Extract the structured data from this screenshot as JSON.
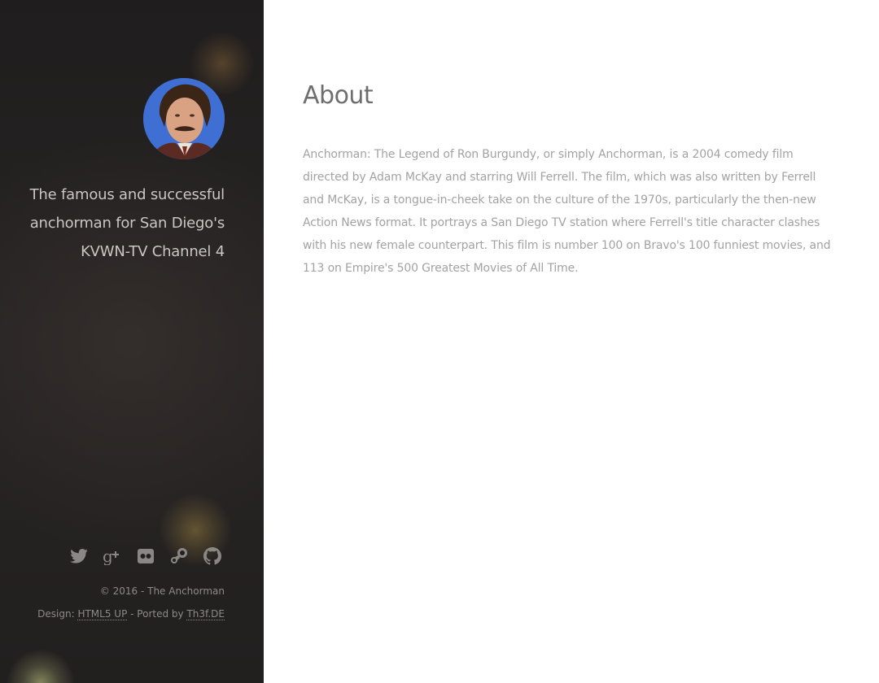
{
  "sidebar": {
    "avatar_alt": "Ron Burgundy",
    "tagline": "The famous and successful anchorman for San Diego's KVWN-TV Channel 4",
    "socials": [
      {
        "name": "twitter-icon"
      },
      {
        "name": "google-plus-icon"
      },
      {
        "name": "flickr-icon"
      },
      {
        "name": "steam-icon"
      },
      {
        "name": "github-icon"
      }
    ],
    "copyright": "© 2016 - The Anchorman",
    "credits_prefix": "Design: ",
    "credits_design_link": "HTML5 UP",
    "credits_middle": " - Ported by ",
    "credits_port_link": "Th3f.DE"
  },
  "main": {
    "title": "About",
    "text": "Anchorman: The Legend of Ron Burgundy, or simply Anchorman, is a 2004 comedy film directed by Adam McKay and starring Will Ferrell. The film, which was also written by Ferrell and McKay, is a tongue-in-cheek take on the culture of the 1970s, particularly the then-new Action News format. It portrays a San Diego TV station where Ferrell's title character clashes with his new female counterpart. This film is number 100 on Bravo's 100 funniest movies, and 113 on Empire's 500 Greatest Movies of All Time."
  },
  "colors": {
    "sidebar_bg": "#222020",
    "sidebar_text": "#c9c6c3",
    "main_title": "#6e6e6e",
    "main_text": "#a2a2a2"
  }
}
